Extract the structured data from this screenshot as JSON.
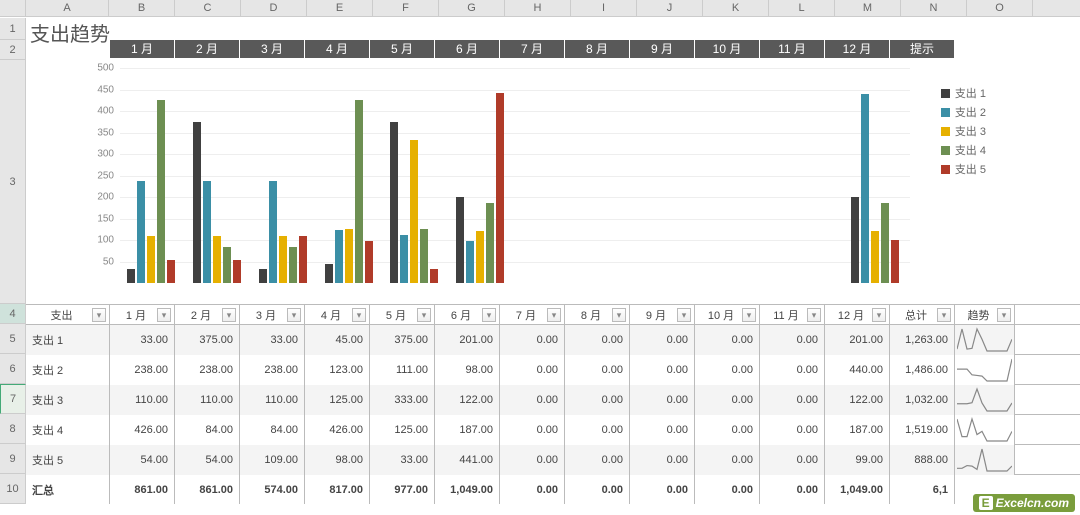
{
  "title": "支出趋势",
  "columns": [
    "A",
    "B",
    "C",
    "D",
    "E",
    "F",
    "G",
    "H",
    "I",
    "J",
    "K",
    "L",
    "M",
    "N",
    "O"
  ],
  "month_headers": [
    "1 月",
    "2 月",
    "3 月",
    "4 月",
    "5 月",
    "6 月",
    "7 月",
    "8 月",
    "9 月",
    "10 月",
    "11 月",
    "12 月",
    "提示"
  ],
  "table_headers": [
    "支出",
    "1 月",
    "2 月",
    "3 月",
    "4 月",
    "5 月",
    "6 月",
    "7 月",
    "8 月",
    "9 月",
    "10 月",
    "11 月",
    "12 月",
    "总计",
    "趋势"
  ],
  "series_labels": [
    "支出 1",
    "支出 2",
    "支出 3",
    "支出 4",
    "支出 5"
  ],
  "colors": {
    "s1": "#404040",
    "s2": "#3b8fa6",
    "s3": "#e6b000",
    "s4": "#6d8f52",
    "s5": "#b03b29"
  },
  "rows": [
    {
      "label": "支出 1",
      "cells": [
        "33.00",
        "375.00",
        "33.00",
        "45.00",
        "375.00",
        "201.00",
        "0.00",
        "0.00",
        "0.00",
        "0.00",
        "0.00",
        "201.00",
        "1,263.00"
      ],
      "values": [
        33,
        375,
        33,
        45,
        375,
        201,
        0,
        0,
        0,
        0,
        0,
        201
      ],
      "total": 1263
    },
    {
      "label": "支出 2",
      "cells": [
        "238.00",
        "238.00",
        "238.00",
        "123.00",
        "111.00",
        "98.00",
        "0.00",
        "0.00",
        "0.00",
        "0.00",
        "0.00",
        "440.00",
        "1,486.00"
      ],
      "values": [
        238,
        238,
        238,
        123,
        111,
        98,
        0,
        0,
        0,
        0,
        0,
        440
      ],
      "total": 1486
    },
    {
      "label": "支出 3",
      "cells": [
        "110.00",
        "110.00",
        "110.00",
        "125.00",
        "333.00",
        "122.00",
        "0.00",
        "0.00",
        "0.00",
        "0.00",
        "0.00",
        "122.00",
        "1,032.00"
      ],
      "values": [
        110,
        110,
        110,
        125,
        333,
        122,
        0,
        0,
        0,
        0,
        0,
        122
      ],
      "total": 1032
    },
    {
      "label": "支出 4",
      "cells": [
        "426.00",
        "84.00",
        "84.00",
        "426.00",
        "125.00",
        "187.00",
        "0.00",
        "0.00",
        "0.00",
        "0.00",
        "0.00",
        "187.00",
        "1,519.00"
      ],
      "values": [
        426,
        84,
        84,
        426,
        125,
        187,
        0,
        0,
        0,
        0,
        0,
        187
      ],
      "total": 1519
    },
    {
      "label": "支出 5",
      "cells": [
        "54.00",
        "54.00",
        "109.00",
        "98.00",
        "33.00",
        "441.00",
        "0.00",
        "0.00",
        "0.00",
        "0.00",
        "0.00",
        "99.00",
        "888.00"
      ],
      "values": [
        54,
        54,
        109,
        98,
        33,
        441,
        0,
        0,
        0,
        0,
        0,
        99
      ],
      "total": 888
    }
  ],
  "totals": {
    "label": "汇总",
    "cells": [
      "861.00",
      "861.00",
      "574.00",
      "817.00",
      "977.00",
      "1,049.00",
      "0.00",
      "0.00",
      "0.00",
      "0.00",
      "0.00",
      "1,049.00",
      "6,1"
    ]
  },
  "chart_data": {
    "type": "bar",
    "title": "支出趋势",
    "ylim": [
      0,
      500
    ],
    "yticks": [
      50,
      100,
      150,
      200,
      250,
      300,
      350,
      400,
      450,
      500
    ],
    "categories": [
      "1 月",
      "2 月",
      "3 月",
      "4 月",
      "5 月",
      "6 月",
      "7 月",
      "8 月",
      "9 月",
      "10 月",
      "11 月",
      "12 月"
    ],
    "series": [
      {
        "name": "支出 1",
        "color": "#404040",
        "values": [
          33,
          375,
          33,
          45,
          375,
          201,
          0,
          0,
          0,
          0,
          0,
          201
        ]
      },
      {
        "name": "支出 2",
        "color": "#3b8fa6",
        "values": [
          238,
          238,
          238,
          123,
          111,
          98,
          0,
          0,
          0,
          0,
          0,
          440
        ]
      },
      {
        "name": "支出 3",
        "color": "#e6b000",
        "values": [
          110,
          110,
          110,
          125,
          333,
          122,
          0,
          0,
          0,
          0,
          0,
          122
        ]
      },
      {
        "name": "支出 4",
        "color": "#6d8f52",
        "values": [
          426,
          84,
          84,
          426,
          125,
          187,
          0,
          0,
          0,
          0,
          0,
          187
        ]
      },
      {
        "name": "支出 5",
        "color": "#b03b29",
        "values": [
          54,
          54,
          109,
          98,
          33,
          441,
          0,
          0,
          0,
          0,
          0,
          99
        ]
      }
    ]
  },
  "watermark": "Excelcn.com"
}
